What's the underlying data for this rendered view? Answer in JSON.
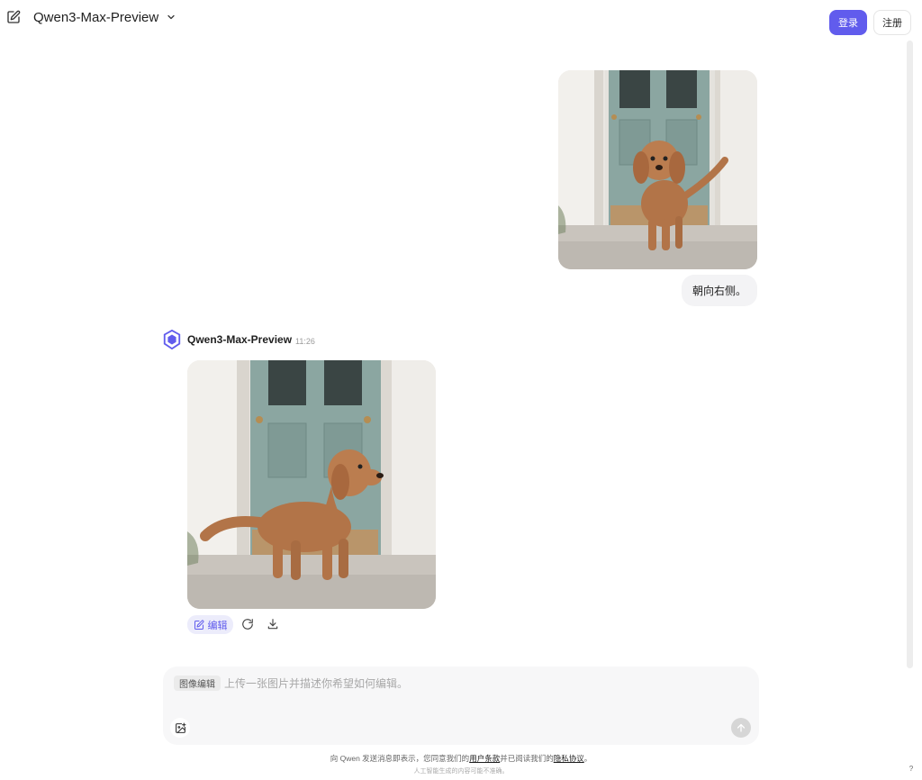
{
  "header": {
    "model_name": "Qwen3-Max-Preview",
    "login_label": "登录",
    "register_label": "注册"
  },
  "conversation": {
    "user_message": "朝向右侧。",
    "assistant_name": "Qwen3-Max-Preview",
    "assistant_time": "11:26",
    "edit_label": "编辑"
  },
  "composer": {
    "mode_tag": "图像编辑",
    "placeholder": "上传一张图片并描述你希望如何编辑。",
    "value": ""
  },
  "footer": {
    "prefix": "向 Qwen 发送消息即表示，您同意我们的",
    "terms": "用户条款",
    "middle": "并已阅读我们的",
    "privacy": "隐私协议",
    "suffix": "。",
    "ai_note": "人工智能生成的内容可能不准确。",
    "help": "?"
  },
  "colors": {
    "accent": "#615ced",
    "door": "#8aa39f",
    "dog": "#b97c4e"
  },
  "icons": [
    "new-chat-icon",
    "chevron-down-icon",
    "qwen-logo-icon",
    "edit-icon",
    "refresh-icon",
    "download-icon",
    "image-upload-icon",
    "arrow-up-icon"
  ]
}
